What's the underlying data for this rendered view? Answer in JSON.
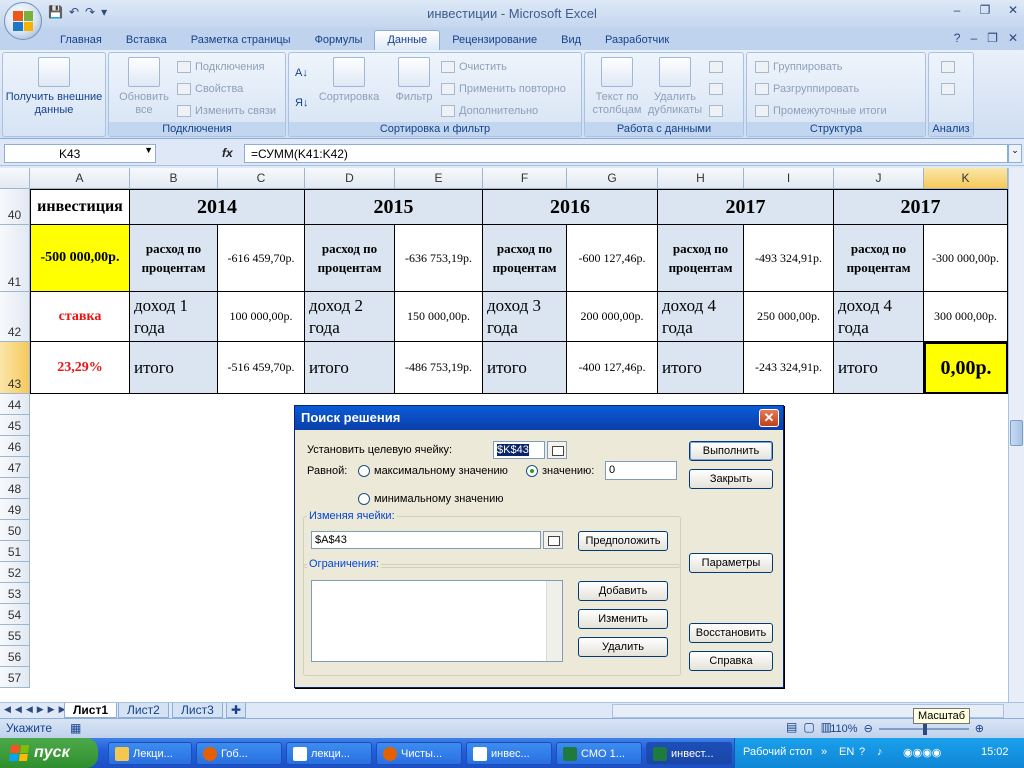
{
  "window": {
    "title": "инвестиции - Microsoft Excel"
  },
  "tabs": [
    "Главная",
    "Вставка",
    "Разметка страницы",
    "Формулы",
    "Данные",
    "Рецензирование",
    "Вид",
    "Разработчик"
  ],
  "ribbon": {
    "get_external": "Получить внешние данные",
    "refresh_all": "Обновить все",
    "connections": "Подключения",
    "properties": "Свойства",
    "edit_links": "Изменить связи",
    "group_connections": "Подключения",
    "sort": "Сортировка",
    "filter": "Фильтр",
    "clear": "Очистить",
    "reapply": "Применить повторно",
    "advanced": "Дополнительно",
    "group_sort": "Сортировка и фильтр",
    "text_to_columns": "Текст по столбцам",
    "remove_dupes": "Удалить дубликаты",
    "group_data": "Работа с данными",
    "group_btn": "Группировать",
    "ungroup_btn": "Разгруппировать",
    "subtotals": "Промежуточные итоги",
    "group_structure": "Структура",
    "group_analysis": "Анализ"
  },
  "formula_bar": {
    "name_box": "K43",
    "formula": "=СУММ(K41:K42)"
  },
  "columns": [
    "A",
    "B",
    "C",
    "D",
    "E",
    "F",
    "G",
    "H",
    "I",
    "J",
    "K"
  ],
  "rows": [
    "40",
    "41",
    "42",
    "43",
    "44",
    "45",
    "46",
    "47",
    "48",
    "49",
    "50",
    "51",
    "52",
    "53",
    "54",
    "55",
    "56",
    "57"
  ],
  "sheet": {
    "a40": "инвестиция",
    "a41": "-500 000,00р.",
    "a42": "ставка",
    "a43": "23,29%",
    "years": [
      "2014",
      "2015",
      "2016",
      "2017",
      "2017"
    ],
    "expense_label": "расход по процентам",
    "income_labels": [
      "доход 1 года",
      "доход 2 года",
      "доход 3 года",
      "доход 4 года",
      "доход 4 года"
    ],
    "total_label": "итого",
    "expenses": [
      "-616 459,70р.",
      "-636 753,19р.",
      "-600 127,46р.",
      "-493 324,91р.",
      "-300 000,00р."
    ],
    "incomes": [
      "100 000,00р.",
      "150 000,00р.",
      "200 000,00р.",
      "250 000,00р.",
      "300 000,00р."
    ],
    "totals": [
      "-516 459,70р.",
      "-486 753,19р.",
      "-400 127,46р.",
      "-243 324,91р.",
      "0,00р."
    ]
  },
  "dialog": {
    "title": "Поиск решения",
    "target_label": "Установить целевую ячейку:",
    "target_value": "$K$43",
    "equal_label": "Равной:",
    "opt_max": "максимальному значению",
    "opt_value": "значению:",
    "opt_value_input": "0",
    "opt_min": "минимальному значению",
    "changing_label": "Изменяя ячейки:",
    "changing_value": "$A$43",
    "guess_btn": "Предположить",
    "constraints_label": "Ограничения:",
    "add_btn": "Добавить",
    "change_btn": "Изменить",
    "delete_btn": "Удалить",
    "run_btn": "Выполнить",
    "close_btn": "Закрыть",
    "params_btn": "Параметры",
    "restore_btn": "Восстановить",
    "help_btn": "Справка"
  },
  "sheet_tabs": [
    "Лист1",
    "Лист2",
    "Лист3"
  ],
  "status": {
    "mode": "Укажите",
    "zoom": "110%",
    "tooltip": "Масштаб"
  },
  "taskbar": {
    "start": "пуск",
    "tasks": [
      "Лекци...",
      "Гоб...",
      "лекци...",
      "Чисты...",
      "инвес...",
      "СМО 1...",
      "инвест..."
    ],
    "desktop": "Рабочий стол",
    "lang": "EN",
    "clock": "15:02"
  },
  "colors": {
    "accent_yellow": "#ffff00",
    "header_blue": "#dbe5f1",
    "red_text": "#ee1111",
    "dialog_title": "#0a4fc4"
  }
}
